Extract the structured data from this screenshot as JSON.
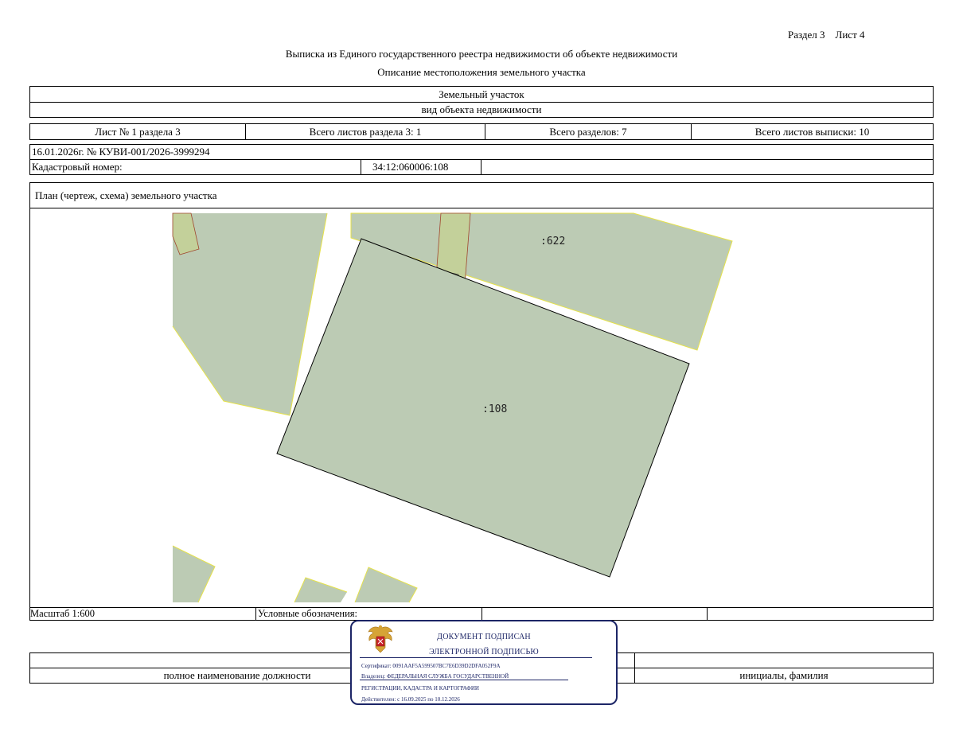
{
  "header": {
    "section_sheet": "Раздел 3    Лист 4",
    "title": "Выписка из Единого государственного реестра недвижимости об объекте недвижимости",
    "subtitle": "Описание местоположения земельного участка"
  },
  "object": {
    "name": "Земельный участок",
    "kind_label": "вид объекта недвижимости"
  },
  "sheets": {
    "sheet_no": "Лист № 1 раздела 3",
    "total_sheets_section": "Всего листов раздела 3: 1",
    "total_sections": "Всего разделов: 7",
    "total_sheets_extract": "Всего листов выписки: 10"
  },
  "doc": {
    "date_number": "16.01.2026г. № КУВИ-001/2026-3999294",
    "cadastral_label": "Кадастровый номер:",
    "cadastral_value": "34:12:060006:108"
  },
  "plan": {
    "title": "План (чертеж, схема) земельного участка",
    "labels": {
      "neighbor": ":622",
      "main": ":108"
    },
    "colors": {
      "parcel_fill": "#bccbb4",
      "neighbor_border": "#e6e24a",
      "main_border": "#000000",
      "building_fill": "#c3d09a",
      "building_border": "#a0462e"
    }
  },
  "footer": {
    "scale": "Масштаб 1:600",
    "legend_label": "Условные обозначения:",
    "position_label": "полное наименование должности",
    "name_label": "инициалы, фамилия"
  },
  "stamp": {
    "line1": "ДОКУМЕНТ ПОДПИСАН",
    "line2": "ЭЛЕКТРОННОЙ ПОДПИСЬЮ",
    "certificate": "Сертификат: 0091AAF5A599507BC7E6D39D2DFA052F9A",
    "owner1": "Владелец: ФЕДЕРАЛЬНАЯ СЛУЖБА ГОСУДАРСТВЕННОЙ",
    "owner2": "РЕГИСТРАЦИИ, КАДАСТРА И КАРТОГРАФИИ",
    "valid": "Действителен: с 16.09.2025 по 10.12.2026",
    "emblem_icon": "double-headed-eagle-emblem-icon",
    "color": "#1c2566"
  }
}
